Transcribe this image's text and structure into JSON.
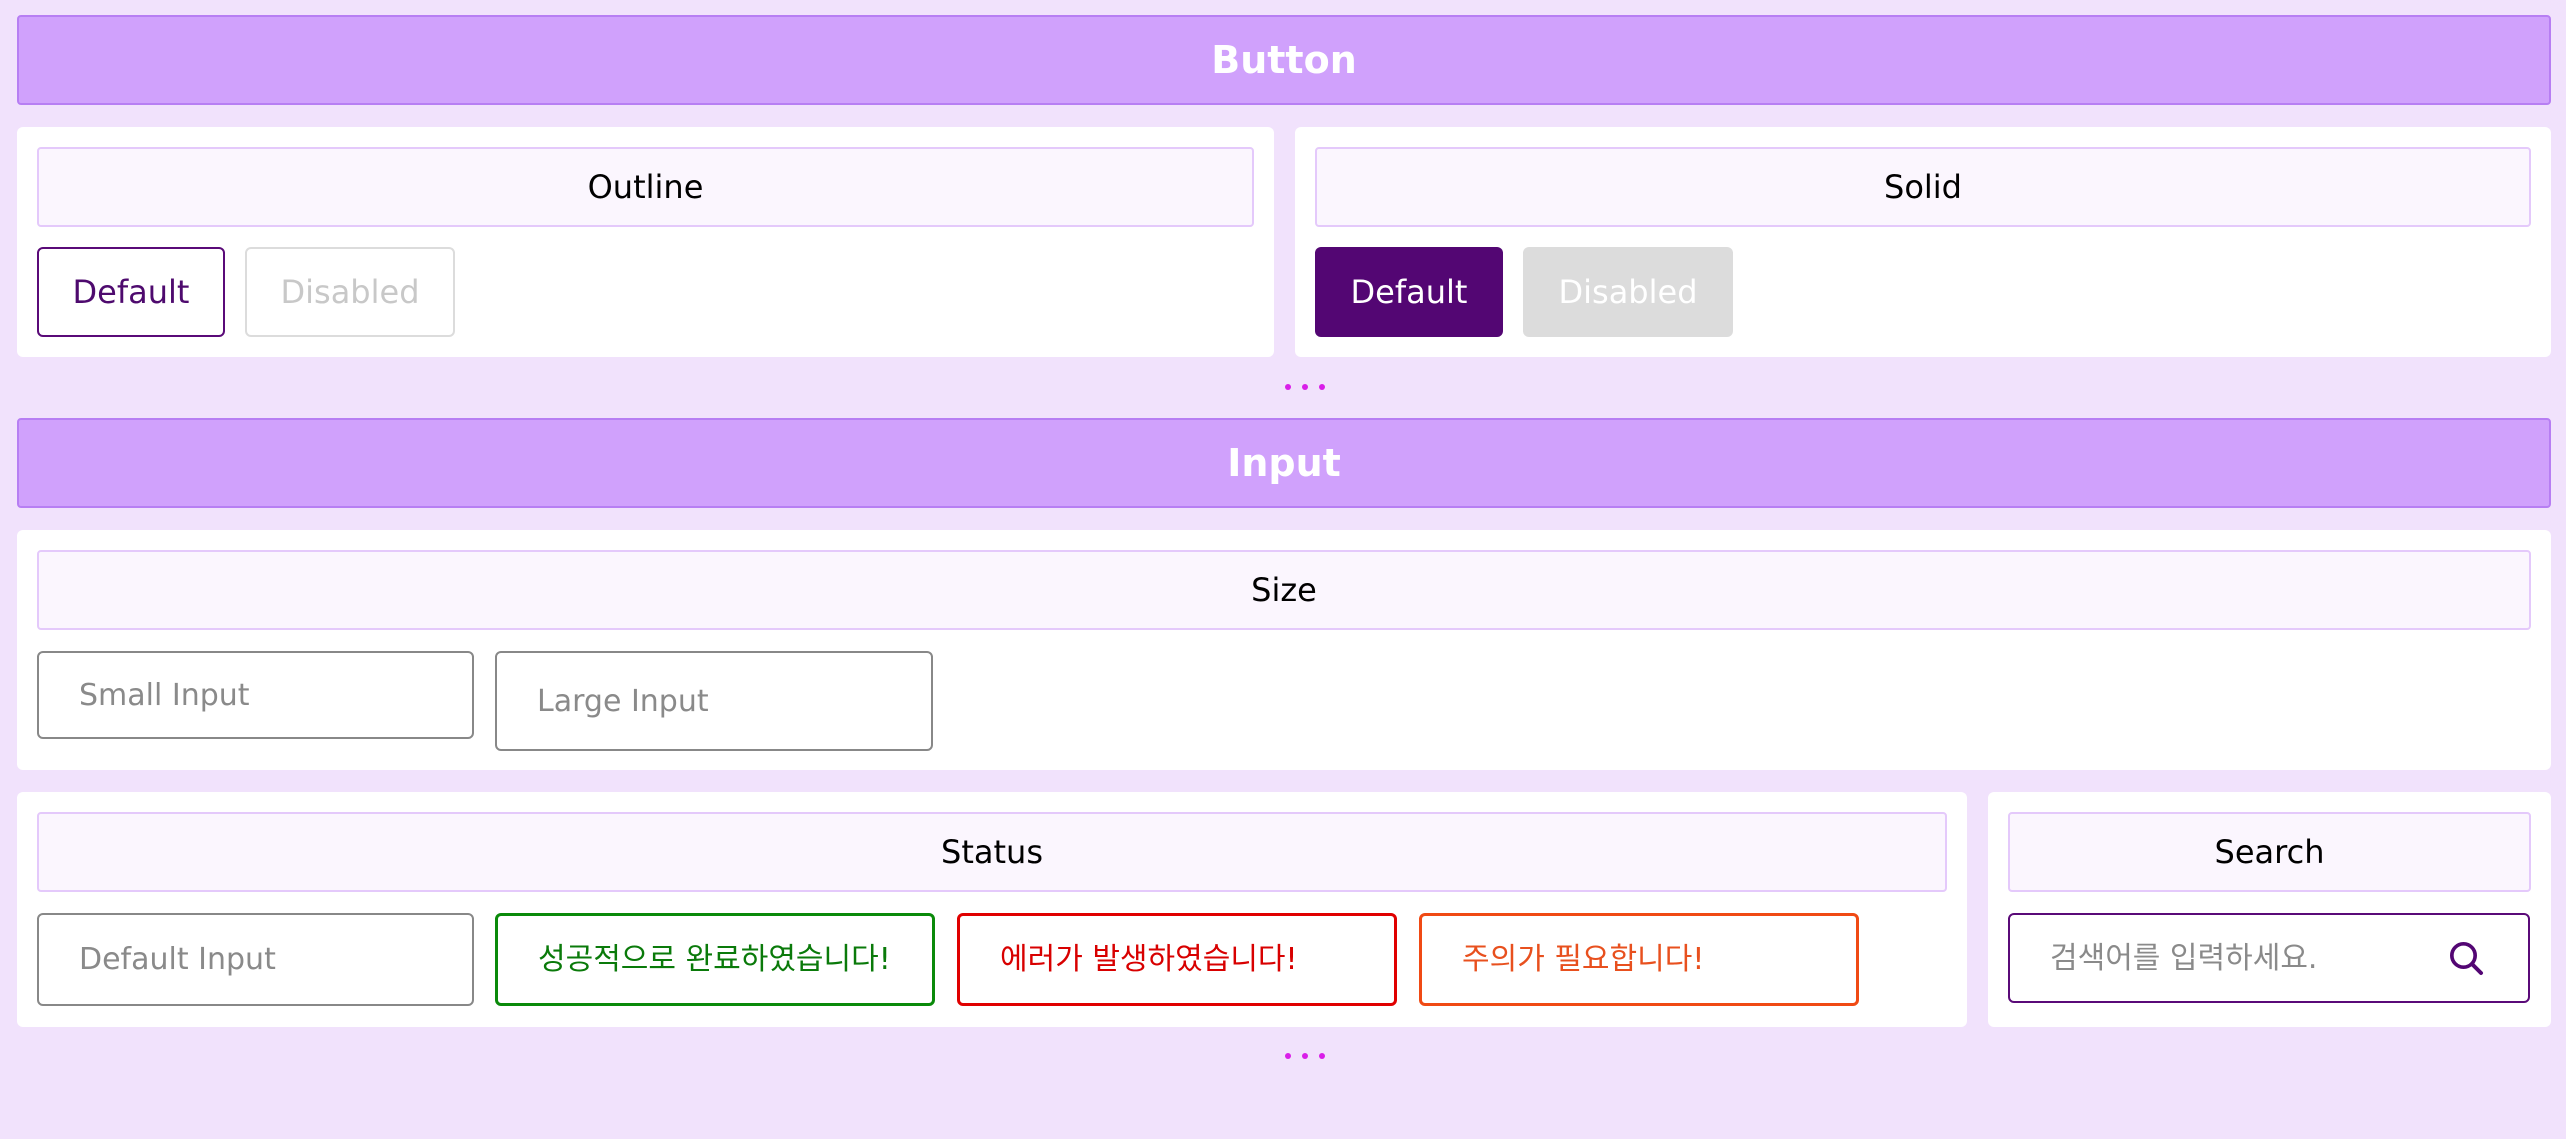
{
  "button_section": {
    "title": "Button",
    "outline": {
      "title": "Outline",
      "default_label": "Default",
      "disabled_label": "Disabled"
    },
    "solid": {
      "title": "Solid",
      "default_label": "Default",
      "disabled_label": "Disabled"
    }
  },
  "input_section": {
    "title": "Input",
    "size": {
      "title": "Size",
      "small_placeholder": "Small Input",
      "large_placeholder": "Large Input"
    },
    "status": {
      "title": "Status",
      "default_placeholder": "Default Input",
      "success_placeholder": "성공적으로 완료하였습니다!",
      "error_placeholder": "에러가 발생하였습니다!",
      "warning_placeholder": "주의가 필요합니다!"
    },
    "search": {
      "title": "Search",
      "placeholder": "검색어를 입력하세요.",
      "icon": "search-icon"
    }
  },
  "colors": {
    "page_background": "#f1e2fc",
    "section_header": "#d0a1fc",
    "primary": "#530673",
    "success": "#0a8a0a",
    "error": "#e00000",
    "warning": "#f04a14"
  }
}
